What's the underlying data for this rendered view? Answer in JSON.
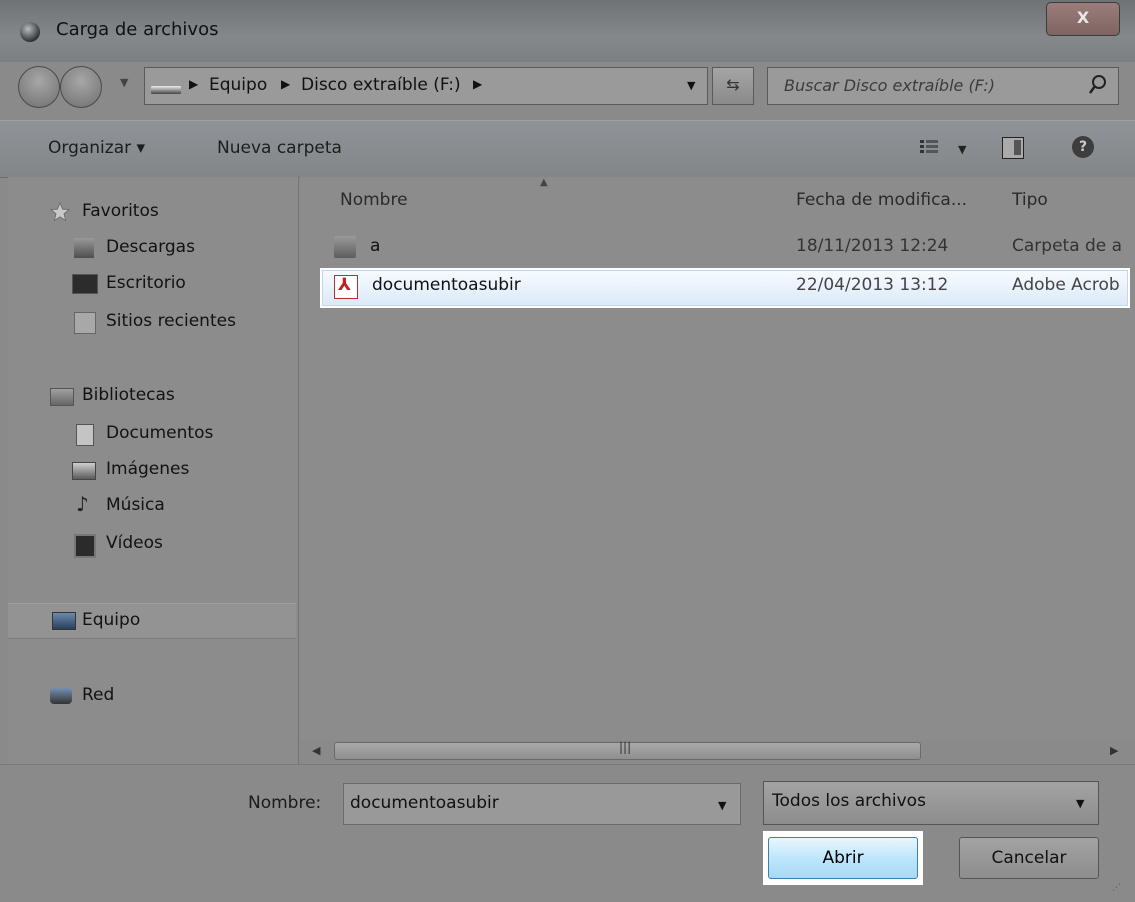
{
  "window": {
    "title": "Carga de archivos",
    "close_label": "X"
  },
  "address_bar": {
    "crumbs": [
      "Equipo",
      "Disco extraíble (F:)"
    ]
  },
  "search": {
    "placeholder": "Buscar Disco extraíble (F:)"
  },
  "toolbar": {
    "organize_label": "Organizar ▾",
    "new_folder_label": "Nueva carpeta",
    "help_label": "?"
  },
  "nav_pane": {
    "favorites": {
      "label": "Favoritos",
      "items": [
        "Descargas",
        "Escritorio",
        "Sitios recientes"
      ]
    },
    "libraries": {
      "label": "Bibliotecas",
      "items": [
        "Documentos",
        "Imágenes",
        "Música",
        "Vídeos"
      ]
    },
    "computer": "Equipo",
    "network": "Red"
  },
  "file_list": {
    "columns": [
      "Nombre",
      "Fecha de modifica...",
      "Tipo"
    ],
    "rows": [
      {
        "name": "a",
        "date": "18/11/2013 12:24",
        "type": "Carpeta de a",
        "icon": "folder-icon"
      },
      {
        "name": "documentoasubir",
        "date": "22/04/2013 13:12",
        "type": "Adobe Acrob",
        "icon": "pdf-icon",
        "selected": true
      }
    ]
  },
  "bottom": {
    "filename_label": "Nombre:",
    "filename_value": "documentoasubir",
    "filter_value": "Todos los archivos",
    "open_label": "Abrir",
    "cancel_label": "Cancelar"
  },
  "colors": {
    "selection": "#dbe9f8",
    "open_button": "#bee6fd",
    "dimmed_background": "#8a8a8a"
  }
}
